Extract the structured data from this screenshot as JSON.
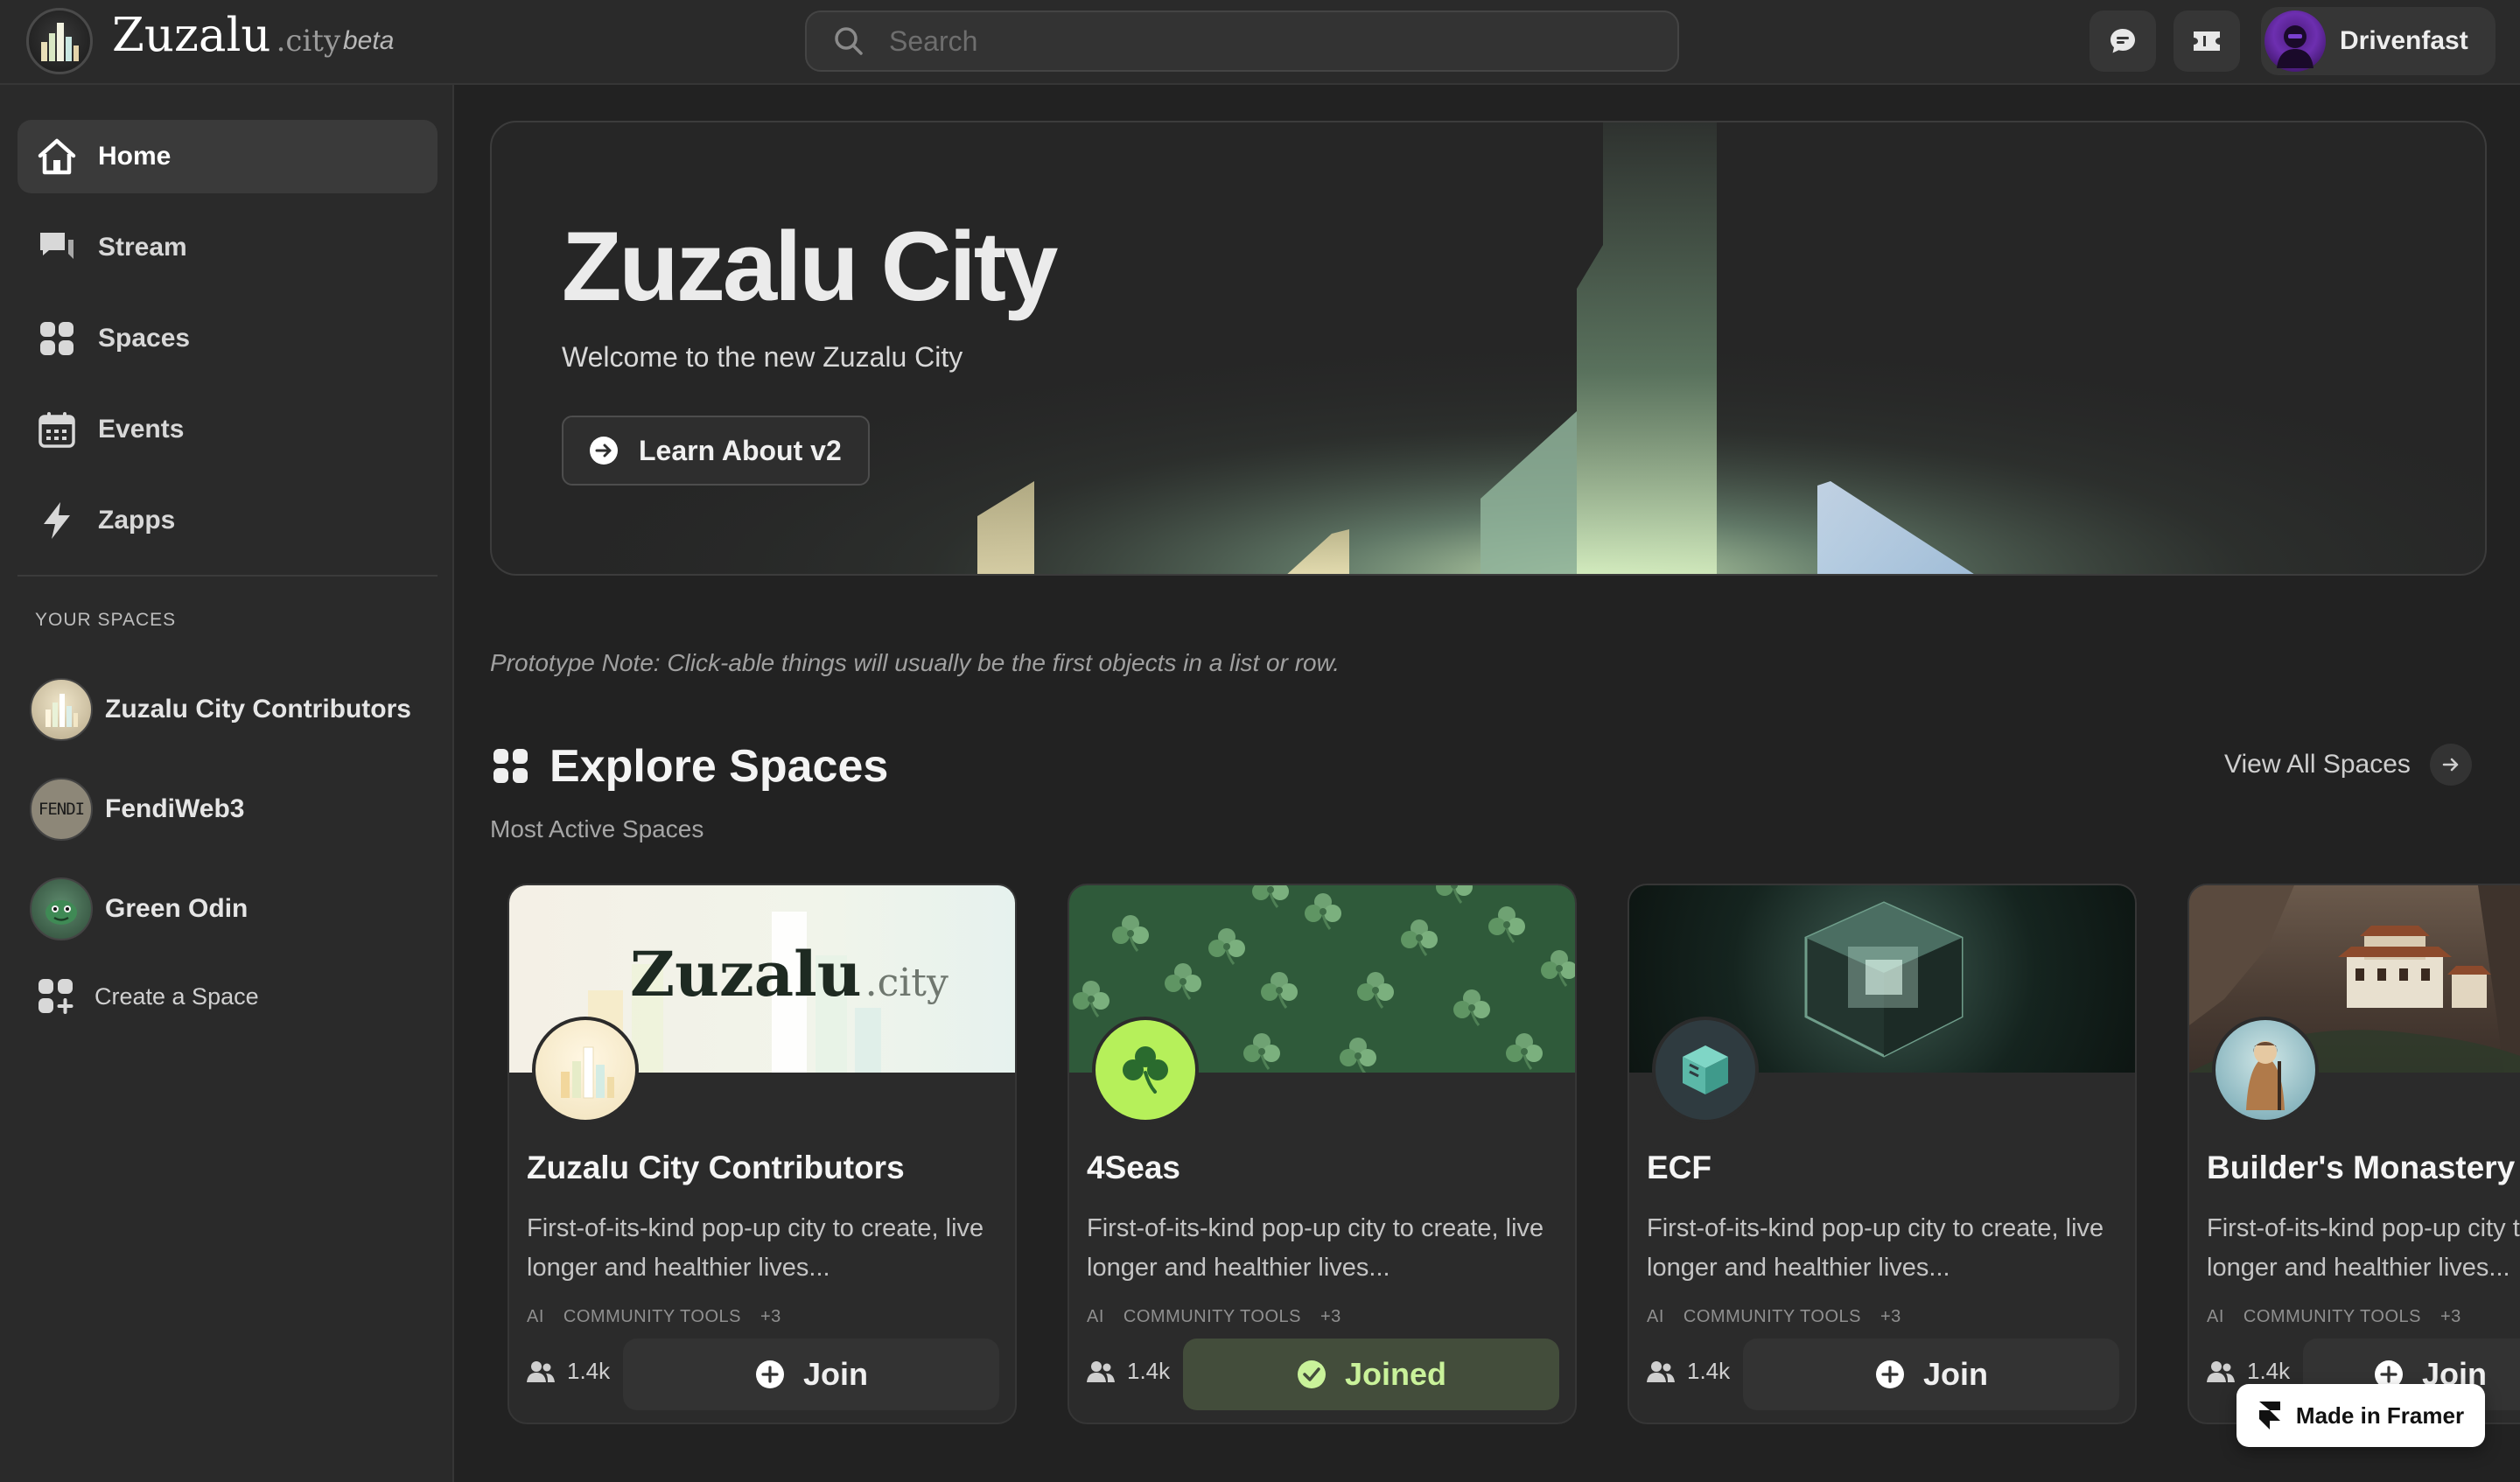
{
  "header": {
    "brand_name": "Zuzalu",
    "brand_suffix": ".city",
    "beta_label": "beta",
    "search_placeholder": "Search",
    "user_name": "Drivenfast"
  },
  "sidebar": {
    "nav": [
      {
        "label": "Home",
        "icon": "home-icon",
        "active": true
      },
      {
        "label": "Stream",
        "icon": "chat-bubbles-icon"
      },
      {
        "label": "Spaces",
        "icon": "grid-icon"
      },
      {
        "label": "Events",
        "icon": "calendar-icon"
      },
      {
        "label": "Zapps",
        "icon": "lightning-icon"
      }
    ],
    "section_label": "YOUR SPACES",
    "spaces": [
      {
        "label": "Zuzalu City Contributors"
      },
      {
        "label": "FendiWeb3",
        "avatar_text": "FENDI"
      },
      {
        "label": "Green Odin"
      }
    ],
    "create_label": "Create a Space"
  },
  "hero": {
    "title": "Zuzalu City",
    "subtitle": "Welcome to the new Zuzalu City",
    "button_label": "Learn About v2"
  },
  "prototype_note": "Prototype Note: Click-able things will usually be the first objects in a list or row.",
  "explore": {
    "title": "Explore Spaces",
    "subtitle": "Most Active Spaces",
    "view_all_label": "View All Spaces",
    "cards": [
      {
        "title": "Zuzalu City Contributors",
        "banner_text": "Zuzalu",
        "banner_suffix": ".city",
        "description": "First-of-its-kind pop-up city to create, live longer and healthier lives...",
        "tags": [
          "AI",
          "COMMUNITY TOOLS",
          "+3"
        ],
        "members": "1.4k",
        "button_label": "Join",
        "joined": false
      },
      {
        "title": "4Seas",
        "description": "First-of-its-kind pop-up city to create, live longer and healthier lives...",
        "tags": [
          "AI",
          "COMMUNITY TOOLS",
          "+3"
        ],
        "members": "1.4k",
        "button_label": "Joined",
        "joined": true
      },
      {
        "title": "ECF",
        "description": "First-of-its-kind pop-up city to create, live longer and healthier lives...",
        "tags": [
          "AI",
          "COMMUNITY TOOLS",
          "+3"
        ],
        "members": "1.4k",
        "button_label": "Join",
        "joined": false
      },
      {
        "title": "Builder's Monastery",
        "description": "First-of-its-kind pop-up city to create, live longer and healthier lives...",
        "tags": [
          "AI",
          "COMMUNITY TOOLS",
          "+3"
        ],
        "members": "1.4k",
        "button_label": "Join",
        "joined": false
      }
    ]
  },
  "framer_badge": "Made in Framer",
  "colors": {
    "background": "#222222",
    "panel": "#2a2a2a",
    "joined_text": "#c9f29a",
    "joined_bg": "#434d3b",
    "accent_green": "#b6f05a"
  }
}
